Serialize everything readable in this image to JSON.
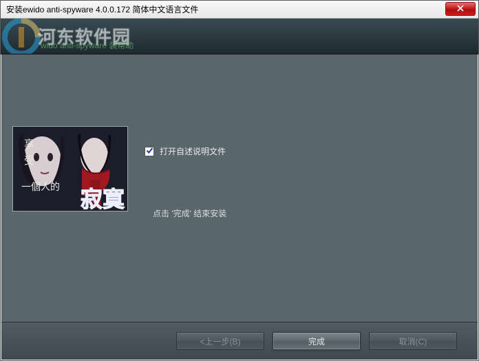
{
  "window": {
    "title": "安装ewido anti-spyware 4.0.0.172 简体中文语言文件"
  },
  "header": {
    "watermark": "河东软件园",
    "subtext": "wido anti-spyware 装帮助"
  },
  "content": {
    "checkbox_label": "打开自述说明文件",
    "checkbox_checked": true,
    "instruction": "点击 '完成' 结束安装"
  },
  "promo": {
    "lines": [
      "享",
      "受",
      "一個人的"
    ],
    "big": "寂寞"
  },
  "buttons": {
    "back": "<上一步(B)",
    "finish": "完成",
    "cancel": "取消(C)"
  },
  "colors": {
    "body_bg": "#59666c",
    "header_dark": "#2b3a40",
    "accent_red": "#c8201a"
  }
}
